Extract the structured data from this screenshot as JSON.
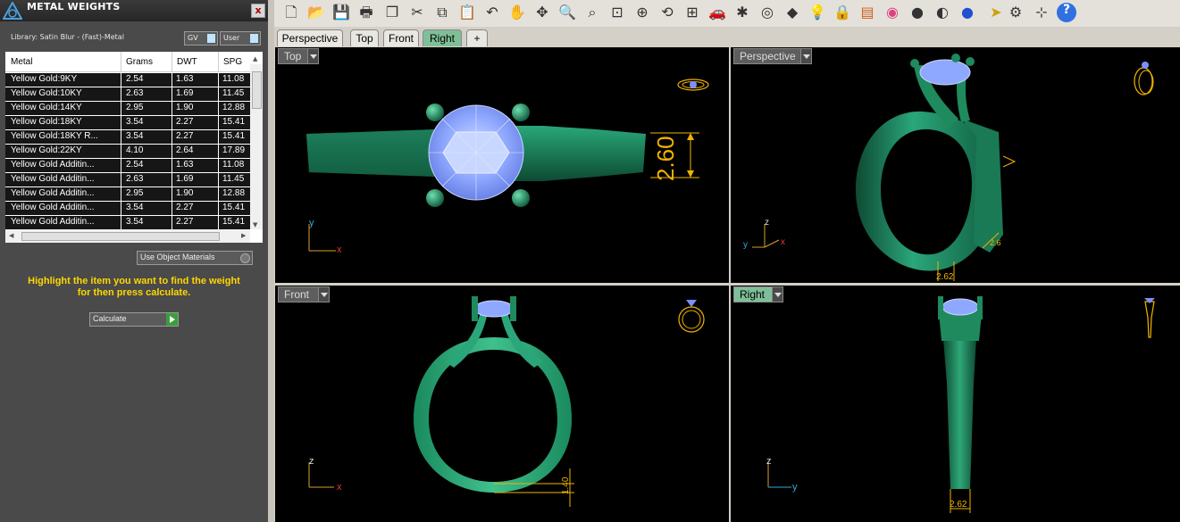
{
  "panel": {
    "title": "METAL WEIGHTS",
    "close_label": "x",
    "library_label": "Library: Satin Blur - (Fast)-Metal",
    "gv_label": "GV",
    "user_label": "User",
    "columns": [
      "Metal",
      "Grams",
      "DWT",
      "SPG"
    ],
    "rows": [
      [
        "Yellow Gold:9KY",
        "2.54",
        "1.63",
        "11.08"
      ],
      [
        "Yellow Gold:10KY",
        "2.63",
        "1.69",
        "11.45"
      ],
      [
        "Yellow Gold:14KY",
        "2.95",
        "1.90",
        "12.88"
      ],
      [
        "Yellow Gold:18KY",
        "3.54",
        "2.27",
        "15.41"
      ],
      [
        "Yellow Gold:18KY R...",
        "3.54",
        "2.27",
        "15.41"
      ],
      [
        "Yellow Gold:22KY",
        "4.10",
        "2.64",
        "17.89"
      ],
      [
        "Yellow Gold Additin...",
        "2.54",
        "1.63",
        "11.08"
      ],
      [
        "Yellow Gold Additin...",
        "2.63",
        "1.69",
        "11.45"
      ],
      [
        "Yellow Gold Additin...",
        "2.95",
        "1.90",
        "12.88"
      ],
      [
        "Yellow Gold Additin...",
        "3.54",
        "2.27",
        "15.41"
      ],
      [
        "Yellow Gold Additin...",
        "3.54",
        "2.27",
        "15.41"
      ]
    ],
    "use_object_materials_label": "Use Object Materials",
    "instruction_line1": "Highlight the item you want to find the weight",
    "instruction_line2": "for then press calculate.",
    "calculate_label": "Calculate"
  },
  "toolbar": {
    "icons": [
      "new-file-icon",
      "open-folder-icon",
      "save-icon",
      "print-icon",
      "copy-file-icon",
      "cut-icon",
      "copy-icon",
      "paste-icon",
      "undo-icon",
      "pan-hand-icon",
      "rotate-view-icon",
      "zoom-icon",
      "zoom-window-icon",
      "zoom-extents-icon",
      "zoom-selected-icon",
      "rotate-icon",
      "four-viewports-icon",
      "car-icon",
      "explode-icon",
      "snap-icon",
      "shapes-icon",
      "light-bulb-icon",
      "lock-icon",
      "layers-icon",
      "color-wheel-icon",
      "sphere-icon",
      "render-sphere-icon",
      "blue-sphere-icon",
      "pointer-icon",
      "gear-icon",
      "grid-snap-icon",
      "help-icon"
    ]
  },
  "view_tabs": [
    {
      "label": "Perspective",
      "active": false
    },
    {
      "label": "Top",
      "active": false
    },
    {
      "label": "Front",
      "active": false
    },
    {
      "label": "Right",
      "active": true
    },
    {
      "label": "+",
      "active": false
    }
  ],
  "viewports": {
    "top": {
      "label": "Top",
      "dimension": "2.60",
      "axis1": "y",
      "axis2": "x"
    },
    "perspective": {
      "label": "Perspective",
      "dimension": "2.62",
      "dimension2": "2.6",
      "axis1": "z",
      "axis2": "y",
      "axis3": "x"
    },
    "front": {
      "label": "Front",
      "dimension": "1.40",
      "axis1": "z",
      "axis2": "x"
    },
    "right": {
      "label": "Right",
      "dimension": "2.62",
      "axis1": "z",
      "axis2": "y"
    }
  },
  "colors": {
    "ring_green": "#1e7a55",
    "gem_blue": "#8fa8ff",
    "dim_yellow": "#f0b400",
    "active_tab": "#7fbf98"
  }
}
